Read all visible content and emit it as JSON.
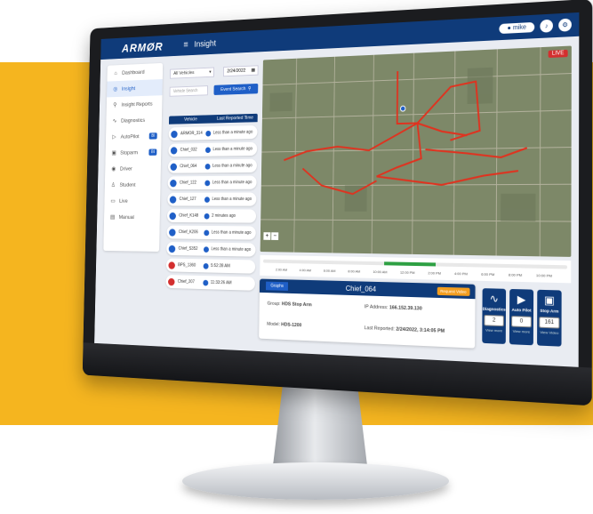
{
  "app": {
    "logo": "ARMØR",
    "section_title": "Insight"
  },
  "header": {
    "user": "mike",
    "help_icon": "bell-icon",
    "settings_icon": "gear-icon"
  },
  "sidebar": {
    "items": [
      {
        "label": "Dashboard",
        "icon": "home-icon"
      },
      {
        "label": "Insight",
        "icon": "insight-icon",
        "active": true
      },
      {
        "label": "Insight Reports",
        "icon": "search-icon"
      },
      {
        "label": "Diagnostics",
        "icon": "pulse-icon"
      },
      {
        "label": "AutoPilot",
        "icon": "play-icon",
        "badge": "BI"
      },
      {
        "label": "Stoparm",
        "icon": "bus-icon",
        "badge": "BI"
      },
      {
        "label": "Driver",
        "icon": "driver-icon"
      },
      {
        "label": "Student",
        "icon": "student-icon"
      },
      {
        "label": "Live",
        "icon": "video-icon"
      },
      {
        "label": "Manual",
        "icon": "book-icon"
      }
    ]
  },
  "filters": {
    "vehicle_select": "All Vehicles",
    "date": "2/24/2022",
    "vehicle_search_placeholder": "Vehicle Search",
    "event_search_label": "Event Search"
  },
  "vehicle_table": {
    "headers": [
      "Vehicle",
      "Last Reported Time"
    ],
    "rows": [
      {
        "name": "ARMOR_314",
        "time": "Less than a minute ago",
        "status": "blue"
      },
      {
        "name": "Chief_032",
        "time": "Less than a minute ago",
        "status": "blue"
      },
      {
        "name": "Chief_064",
        "time": "Less than a minute ago",
        "status": "blue"
      },
      {
        "name": "Chief_122",
        "time": "Less than a minute ago",
        "status": "blue"
      },
      {
        "name": "Chief_127",
        "time": "Less than a minute ago",
        "status": "blue"
      },
      {
        "name": "Chief_K148",
        "time": "2 minutes ago",
        "status": "blue"
      },
      {
        "name": "Chief_K206",
        "time": "Less than a minute ago",
        "status": "blue"
      },
      {
        "name": "Chief_S352",
        "time": "Less than a minute ago",
        "status": "blue"
      },
      {
        "name": "BPS_1360",
        "time": "5:52:28 AM",
        "status": "red"
      },
      {
        "name": "Chief_207",
        "time": "11:33:26 AM",
        "status": "red"
      }
    ]
  },
  "map": {
    "live_label": "LIVE",
    "zoom_in": "+",
    "zoom_out": "−"
  },
  "timeline": {
    "labels": [
      "2:00 AM",
      "4:00 AM",
      "6:00 AM",
      "8:00 AM",
      "10:00 AM",
      "12:00 PM",
      "2:00 PM",
      "4:00 PM",
      "6:00 PM",
      "8:00 PM",
      "10:00 PM"
    ]
  },
  "details": {
    "tab": "Graphs",
    "title": "Chief_064",
    "request_video": "Request Video",
    "group_label": "Group:",
    "group_value": "HDS Stop Arm",
    "model_label": "Model:",
    "model_value": "HDS-1200",
    "ip_label": "IP Address:",
    "ip_value": "166.152.39.130",
    "last_label": "Last Reported:",
    "last_value": "2/24/2022, 3:14:05 PM"
  },
  "stats": [
    {
      "label": "Diagnostics",
      "value": "2",
      "link": "View more",
      "icon": "pulse-icon"
    },
    {
      "label": "Auto Pilot",
      "value": "0",
      "link": "View more",
      "icon": "play-icon"
    },
    {
      "label": "Stop Arm",
      "value": "161",
      "link": "View Video",
      "icon": "bus-icon"
    }
  ],
  "colors": {
    "primary": "#0f3b7a",
    "accent": "#f5b51f",
    "live": "#d32f2f"
  }
}
